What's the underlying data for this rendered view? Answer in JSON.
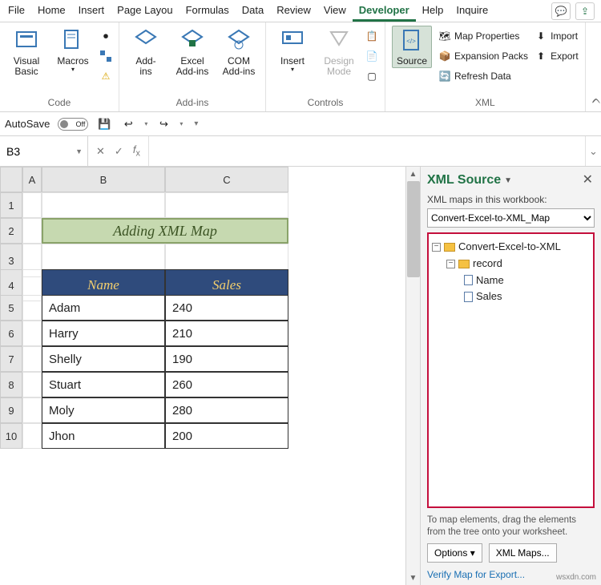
{
  "menu": {
    "items": [
      "File",
      "Home",
      "Insert",
      "Page Layou",
      "Formulas",
      "Data",
      "Review",
      "View",
      "Developer",
      "Help",
      "Inquire"
    ],
    "active": "Developer"
  },
  "ribbon": {
    "groups": {
      "code": {
        "label": "Code",
        "visual_basic": "Visual\nBasic",
        "macros": "Macros"
      },
      "addins": {
        "label": "Add-ins",
        "addins": "Add-\nins",
        "excel": "Excel\nAdd-ins",
        "com": "COM\nAdd-ins"
      },
      "controls": {
        "label": "Controls",
        "insert": "Insert",
        "design": "Design\nMode"
      },
      "xml": {
        "label": "XML",
        "source": "Source",
        "map_props": "Map Properties",
        "expansion": "Expansion Packs",
        "refresh": "Refresh Data",
        "import": "Import",
        "export": "Export"
      }
    }
  },
  "qat": {
    "autosave_label": "AutoSave",
    "autosave_state": "Off"
  },
  "formula": {
    "namebox": "B3",
    "fx": ""
  },
  "sheet": {
    "columns": [
      "A",
      "B",
      "C"
    ],
    "rows": [
      "1",
      "2",
      "3",
      "4",
      "5",
      "6",
      "7",
      "8",
      "9",
      "10"
    ],
    "title": "Adding XML Map",
    "headers": [
      "Name",
      "Sales"
    ],
    "data": [
      {
        "name": "Adam",
        "sales": "240"
      },
      {
        "name": "Harry",
        "sales": "210"
      },
      {
        "name": "Shelly",
        "sales": "190"
      },
      {
        "name": "Stuart",
        "sales": "260"
      },
      {
        "name": "Moly",
        "sales": "280"
      },
      {
        "name": "Jhon",
        "sales": "200"
      }
    ]
  },
  "xmlpane": {
    "title": "XML Source",
    "label": "XML maps in this workbook:",
    "selected_map": "Convert-Excel-to-XML_Map",
    "tree": {
      "root": "Convert-Excel-to-XML",
      "child": "record",
      "leaves": [
        "Name",
        "Sales"
      ]
    },
    "hint": "To map elements, drag the elements from the tree onto your worksheet.",
    "options": "Options",
    "xml_maps": "XML Maps...",
    "verify": "Verify Map for Export..."
  },
  "watermark": "wsxdn.com"
}
